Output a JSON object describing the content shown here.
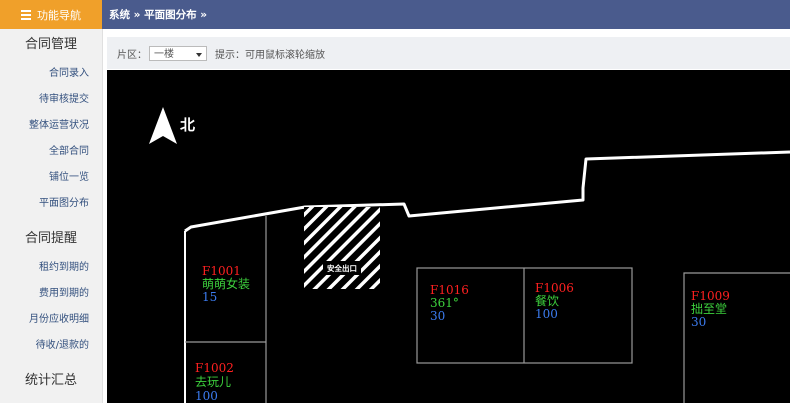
{
  "nav": {
    "tab_label": "功能导航",
    "icon": "menu-icon"
  },
  "breadcrumb": "系统 » 平面图分布 »",
  "sidebar": {
    "groups": [
      {
        "title": "合同管理",
        "items": [
          "合同录入",
          "待审核提交",
          "整体运营状况",
          "全部合同",
          "铺位一览",
          "平面图分布"
        ]
      },
      {
        "title": "合同提醒",
        "items": [
          "租约到期的",
          "费用到期的",
          "月份应收明细",
          "待收/退款的"
        ]
      },
      {
        "title": "统计汇总",
        "items": []
      }
    ]
  },
  "toolbar": {
    "zone_label": "片区：",
    "zone_value": "一楼",
    "hint": "提示：可用鼠标滚轮缩放"
  },
  "map": {
    "north_label": "北",
    "exit_label": "安全出口",
    "colors": {
      "code": "#ff2020",
      "name": "#3dd13d",
      "area": "#3c7cf0",
      "line": "#ffffff"
    },
    "units": [
      {
        "code": "F1001",
        "name": "萌萌女装",
        "area": "15"
      },
      {
        "code": "F1002",
        "name": "去玩儿",
        "area": "100"
      },
      {
        "code": "F1016",
        "name": "361°",
        "area": "30"
      },
      {
        "code": "F1006",
        "name": "餐饮",
        "area": "100"
      },
      {
        "code": "F1009",
        "name": "拙至堂",
        "area": "30"
      }
    ]
  }
}
